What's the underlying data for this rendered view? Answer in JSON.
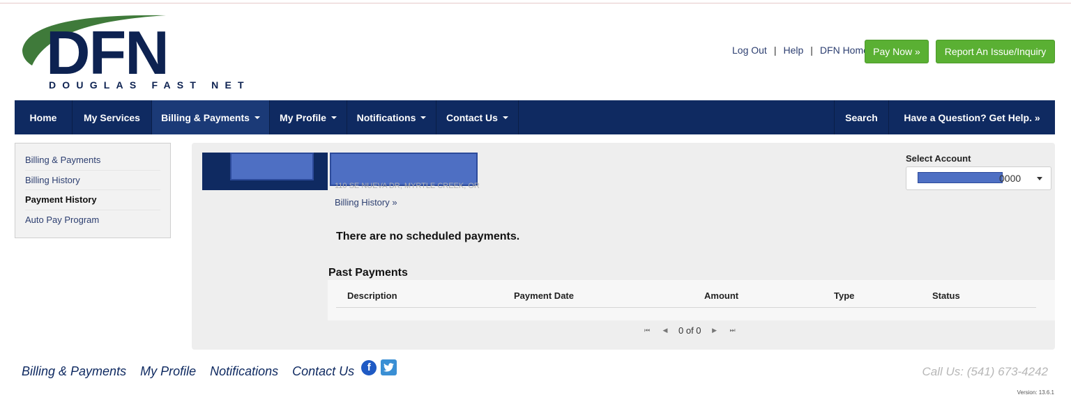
{
  "brand": {
    "tagline": "DOUGLAS FAST NET",
    "colors": {
      "navy": "#0f2a61",
      "green": "#5ab033",
      "arc": "#3f7a3a"
    }
  },
  "header": {
    "links": [
      "Log Out",
      "Help",
      "DFN Home"
    ],
    "pay_now": "Pay Now »",
    "report": "Report An Issue/Inquiry"
  },
  "nav": {
    "items": [
      {
        "label": "Home",
        "dropdown": false
      },
      {
        "label": "My Services",
        "dropdown": false
      },
      {
        "label": "Billing & Payments",
        "dropdown": true
      },
      {
        "label": "My Profile",
        "dropdown": true
      },
      {
        "label": "Notifications",
        "dropdown": true
      },
      {
        "label": "Contact Us",
        "dropdown": true
      }
    ],
    "search": "Search",
    "help": "Have a Question? Get Help. »"
  },
  "sidebar": {
    "items": [
      "Billing & Payments",
      "Billing History",
      "Payment History",
      "Auto Pay Program"
    ]
  },
  "account": {
    "address": "110 SE NUEVA DR, MYRTLE CREEK, OR",
    "billing_history_link": "Billing History »",
    "select_label": "Select Account",
    "select_value_suffix": "0000"
  },
  "content": {
    "no_scheduled": "There are no scheduled payments.",
    "past_payments_title": "Past Payments",
    "columns": [
      "Description",
      "Payment Date",
      "Amount",
      "Type",
      "Status"
    ],
    "pager_text": "0 of 0"
  },
  "footer": {
    "links": [
      "Billing & Payments",
      "My Profile",
      "Notifications",
      "Contact Us"
    ],
    "call_us": "Call Us: (541) 673-4242",
    "version": "Version: 13.6.1"
  }
}
